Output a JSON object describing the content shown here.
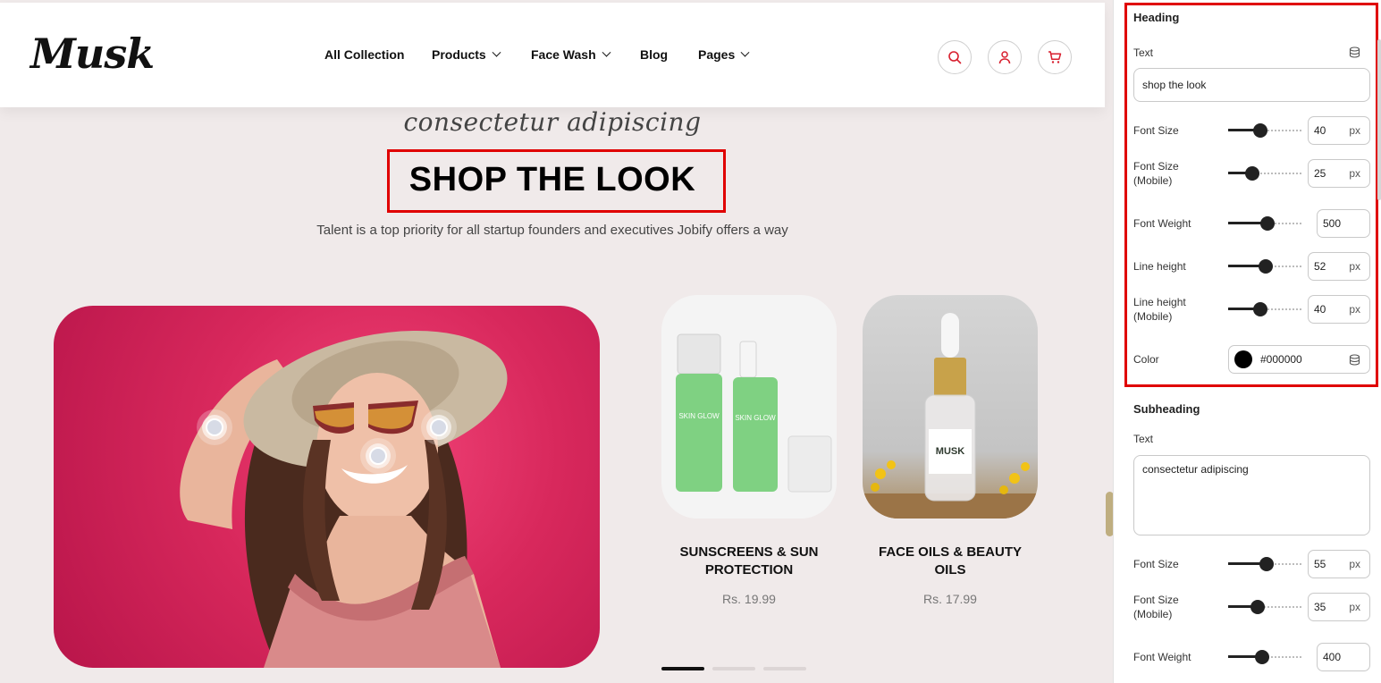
{
  "header": {
    "logo": "Musk",
    "nav": [
      {
        "label": "All Collection",
        "dropdown": false
      },
      {
        "label": "Products",
        "dropdown": true
      },
      {
        "label": "Face Wash",
        "dropdown": true
      },
      {
        "label": "Blog",
        "dropdown": false
      },
      {
        "label": "Pages",
        "dropdown": true
      }
    ],
    "icons": [
      "search-icon",
      "user-icon",
      "cart-icon"
    ]
  },
  "section": {
    "subheading": "consectetur adipiscing",
    "heading": "SHOP THE LOOK",
    "description": "Talent is a top priority for all startup founders and executives Jobify offers a way"
  },
  "products": [
    {
      "title": "SUNSCREENS & SUN PROTECTION",
      "price": "Rs. 19.99"
    },
    {
      "title": "FACE OILS & BEAUTY OILS",
      "price": "Rs. 17.99"
    }
  ],
  "bottle_label": {
    "brand": "MUSK",
    "product": "SKIN GLOW"
  },
  "carousel": {
    "active_index": 0,
    "count": 3
  },
  "settings": {
    "heading": {
      "title": "Heading",
      "text_label": "Text",
      "text_value": "shop the look",
      "font_size": {
        "label": "Font Size",
        "value": "40",
        "unit": "px",
        "level": 0.42
      },
      "font_size_mobile": {
        "label": "Font Size (Mobile)",
        "value": "25",
        "unit": "px",
        "level": 0.29
      },
      "font_weight": {
        "label": "Font Weight",
        "value": "500",
        "level": 0.55
      },
      "line_height": {
        "label": "Line height",
        "value": "52",
        "unit": "px",
        "level": 0.51
      },
      "line_height_mobile": {
        "label": "Line height (Mobile)",
        "value": "40",
        "unit": "px",
        "level": 0.42
      },
      "color": {
        "label": "Color",
        "value": "#000000"
      }
    },
    "subheading": {
      "title": "Subheading",
      "text_label": "Text",
      "text_value": "consectetur adipiscing",
      "font_size": {
        "label": "Font Size",
        "value": "55",
        "unit": "px",
        "level": 0.53
      },
      "font_size_mobile": {
        "label": "Font Size (Mobile)",
        "value": "35",
        "unit": "px",
        "level": 0.38
      },
      "font_weight": {
        "label": "Font Weight",
        "value": "400",
        "level": 0.45
      }
    }
  },
  "colors": {
    "highlight": "#e00000",
    "accent": "#d81f2e",
    "page_bg": "#f0eaea"
  }
}
